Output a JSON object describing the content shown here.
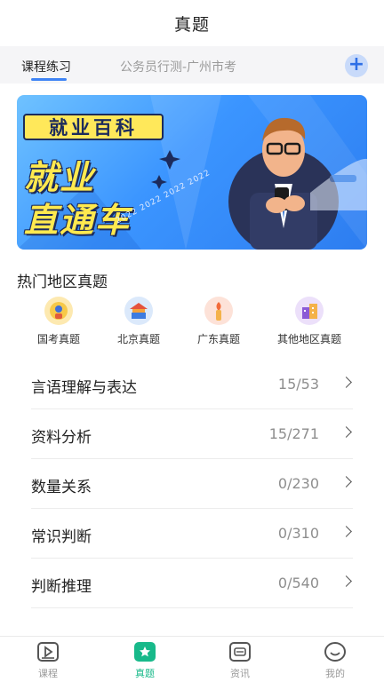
{
  "header": {
    "title": "真题"
  },
  "tabs": [
    {
      "label": "课程练习",
      "active": true
    },
    {
      "label": "公务员行测-广州市考",
      "active": false
    }
  ],
  "banner": {
    "badge": "就业百科",
    "line1": "就业",
    "line2": "直通车",
    "year_strip": "2022 2022 2022 2022"
  },
  "hot_regions": {
    "title": "热门地区真题",
    "items": [
      {
        "label": "国考真题",
        "icon": "national-emblem-icon"
      },
      {
        "label": "北京真题",
        "icon": "temple-icon"
      },
      {
        "label": "广东真题",
        "icon": "torch-icon"
      },
      {
        "label": "其他地区真题",
        "icon": "buildings-icon"
      }
    ]
  },
  "categories": [
    {
      "name": "言语理解与表达",
      "count": "15/53"
    },
    {
      "name": "资料分析",
      "count": "15/271"
    },
    {
      "name": "数量关系",
      "count": "0/230"
    },
    {
      "name": "常识判断",
      "count": "0/310"
    },
    {
      "name": "判断推理",
      "count": "0/540"
    }
  ],
  "bottom_nav": [
    {
      "label": "课程",
      "icon": "play-icon",
      "active": false
    },
    {
      "label": "真题",
      "icon": "star-icon",
      "active": true
    },
    {
      "label": "资讯",
      "icon": "news-icon",
      "active": false
    },
    {
      "label": "我的",
      "icon": "profile-icon",
      "active": false
    }
  ],
  "colors": {
    "accent": "#3f84f5",
    "active_nav": "#18b98a",
    "banner_yellow": "#ffe94f"
  }
}
